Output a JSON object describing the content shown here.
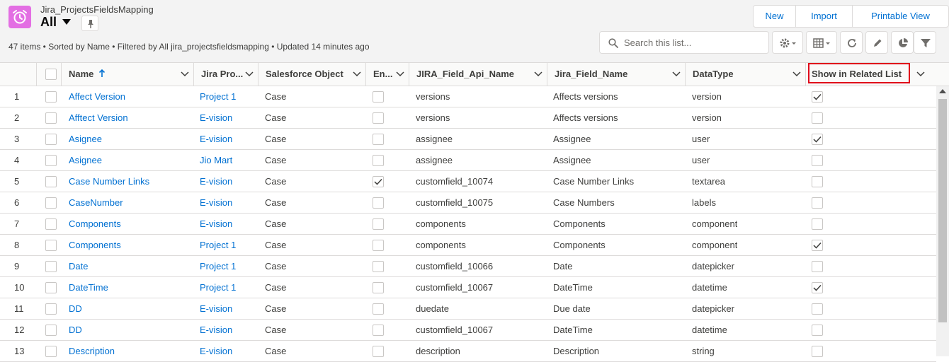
{
  "header": {
    "object_label": "Jira_ProjectsFieldsMapping",
    "list_view": "All",
    "meta": "47 items • Sorted by Name • Filtered by All jira_projectsfieldsmapping • Updated 14 minutes ago"
  },
  "actions": {
    "new_label": "New",
    "import_label": "Import",
    "printable_label": "Printable View"
  },
  "search": {
    "placeholder": "Search this list..."
  },
  "columns": [
    "Name",
    "Jira Pro...",
    "Salesforce Object",
    "En...",
    "JIRA_Field_Api_Name",
    "Jira_Field_Name",
    "DataType",
    "Show in Related List"
  ],
  "rows": [
    {
      "n": "1",
      "name": "Affect Version",
      "project": "Project 1",
      "object": "Case",
      "enabled": false,
      "api": "versions",
      "field": "Affects versions",
      "type": "version",
      "related": true
    },
    {
      "n": "2",
      "name": "Afftect Version",
      "project": "E-vision",
      "object": "Case",
      "enabled": false,
      "api": "versions",
      "field": "Affects versions",
      "type": "version",
      "related": false
    },
    {
      "n": "3",
      "name": "Asignee",
      "project": "E-vision",
      "object": "Case",
      "enabled": false,
      "api": "assignee",
      "field": "Assignee",
      "type": "user",
      "related": true
    },
    {
      "n": "4",
      "name": "Asignee",
      "project": "Jio Mart",
      "object": "Case",
      "enabled": false,
      "api": "assignee",
      "field": "Assignee",
      "type": "user",
      "related": false
    },
    {
      "n": "5",
      "name": "Case Number Links",
      "project": "E-vision",
      "object": "Case",
      "enabled": true,
      "api": "customfield_10074",
      "field": "Case Number Links",
      "type": "textarea",
      "related": false
    },
    {
      "n": "6",
      "name": "CaseNumber",
      "project": "E-vision",
      "object": "Case",
      "enabled": false,
      "api": "customfield_10075",
      "field": "Case Numbers",
      "type": "labels",
      "related": false
    },
    {
      "n": "7",
      "name": "Components",
      "project": "E-vision",
      "object": "Case",
      "enabled": false,
      "api": "components",
      "field": "Components",
      "type": "component",
      "related": false
    },
    {
      "n": "8",
      "name": "Components",
      "project": "Project 1",
      "object": "Case",
      "enabled": false,
      "api": "components",
      "field": "Components",
      "type": "component",
      "related": true
    },
    {
      "n": "9",
      "name": "Date",
      "project": "Project 1",
      "object": "Case",
      "enabled": false,
      "api": "customfield_10066",
      "field": "Date",
      "type": "datepicker",
      "related": false
    },
    {
      "n": "10",
      "name": "DateTime",
      "project": "Project 1",
      "object": "Case",
      "enabled": false,
      "api": "customfield_10067",
      "field": "DateTime",
      "type": "datetime",
      "related": true
    },
    {
      "n": "11",
      "name": "DD",
      "project": "E-vision",
      "object": "Case",
      "enabled": false,
      "api": "duedate",
      "field": "Due date",
      "type": "datepicker",
      "related": false
    },
    {
      "n": "12",
      "name": "DD",
      "project": "E-vision",
      "object": "Case",
      "enabled": false,
      "api": "customfield_10067",
      "field": "DateTime",
      "type": "datetime",
      "related": false
    },
    {
      "n": "13",
      "name": "Description",
      "project": "E-vision",
      "object": "Case",
      "enabled": false,
      "api": "description",
      "field": "Description",
      "type": "string",
      "related": false
    }
  ]
}
